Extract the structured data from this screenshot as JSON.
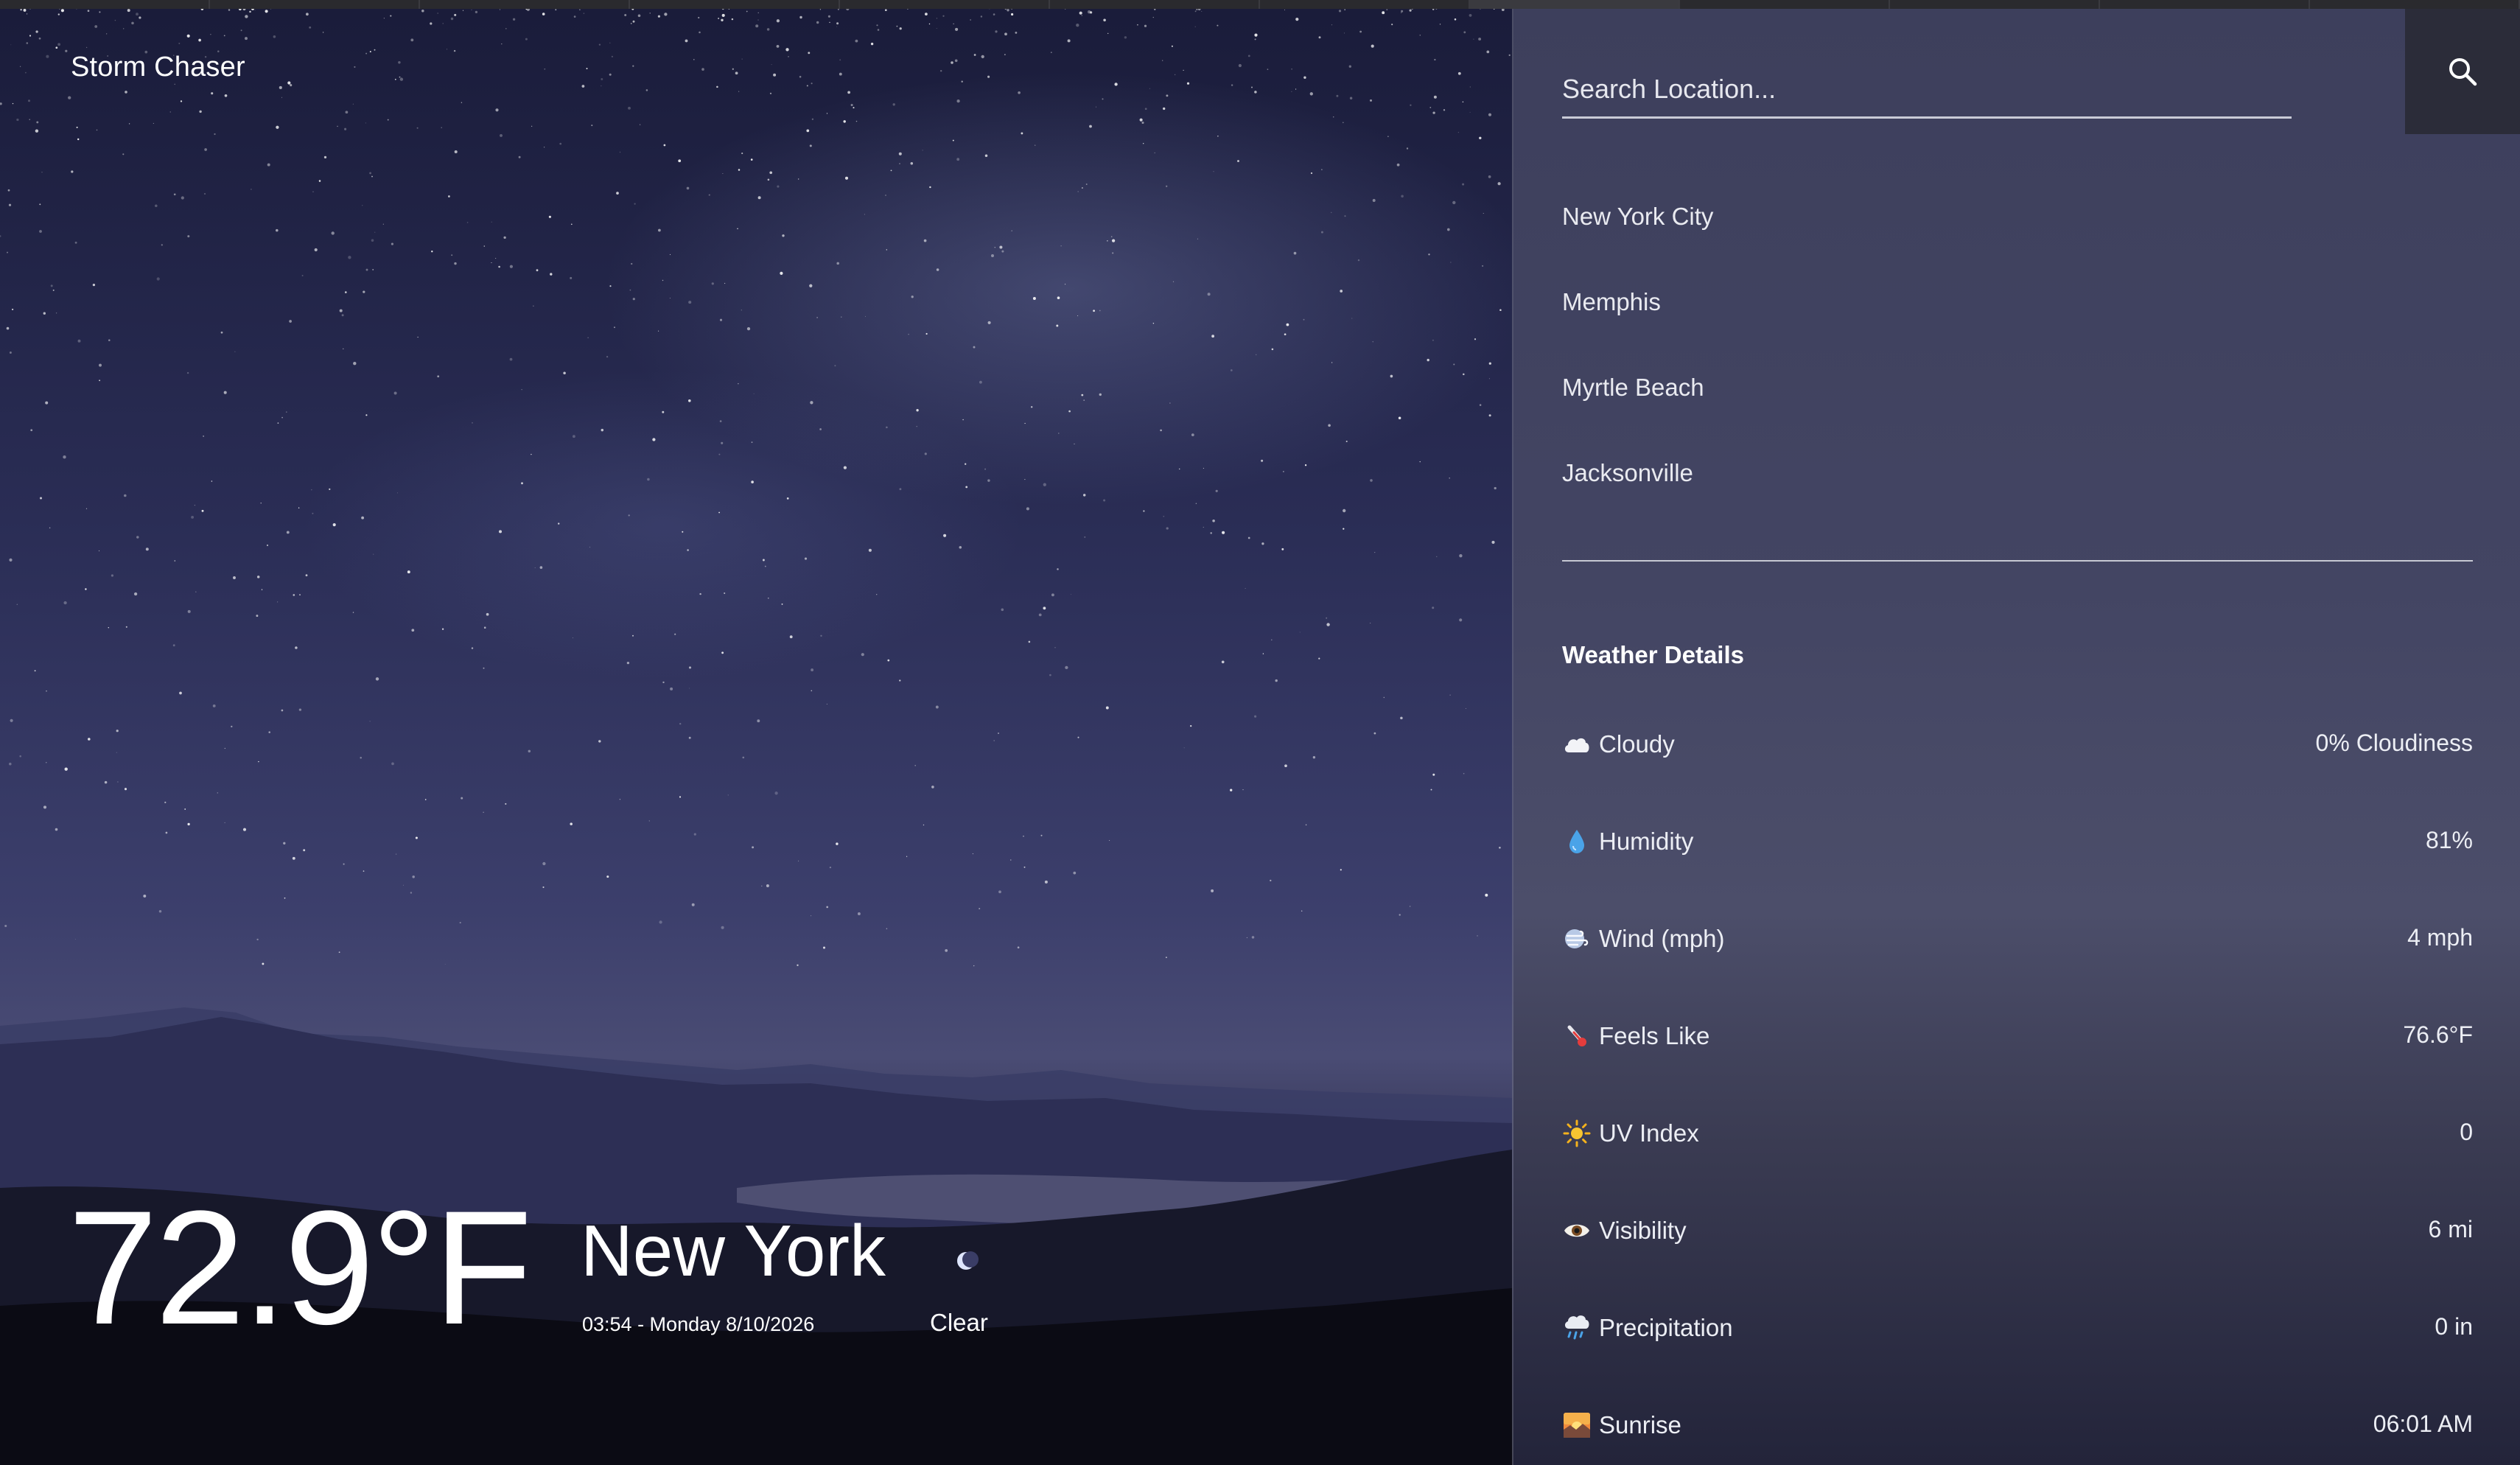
{
  "app": {
    "title": "Storm Chaser"
  },
  "current": {
    "temperature": "72.9°F",
    "city": "New York",
    "datetime": "03:54 - Monday 8/10/2026",
    "condition": "Clear",
    "condition_icon": "crescent-moon-icon"
  },
  "search": {
    "placeholder": "Search Location...",
    "value": "",
    "button_icon": "search-icon"
  },
  "locations": [
    {
      "label": "New York City"
    },
    {
      "label": "Memphis"
    },
    {
      "label": "Myrtle Beach"
    },
    {
      "label": "Jacksonville"
    }
  ],
  "details": {
    "title": "Weather Details",
    "items": [
      {
        "icon": "cloud-icon",
        "label": "Cloudy",
        "value": "0% Cloudiness"
      },
      {
        "icon": "droplet-icon",
        "label": "Humidity",
        "value": "81%"
      },
      {
        "icon": "wind-icon",
        "label": "Wind (mph)",
        "value": "4 mph"
      },
      {
        "icon": "thermometer-icon",
        "label": "Feels Like",
        "value": "76.6°F"
      },
      {
        "icon": "sun-icon",
        "label": "UV Index",
        "value": "0"
      },
      {
        "icon": "eye-icon",
        "label": "Visibility",
        "value": "6 mi"
      },
      {
        "icon": "rain-cloud-icon",
        "label": "Precipitation",
        "value": "0 in"
      },
      {
        "icon": "sunrise-icon",
        "label": "Sunrise",
        "value": "06:01 AM"
      }
    ]
  }
}
